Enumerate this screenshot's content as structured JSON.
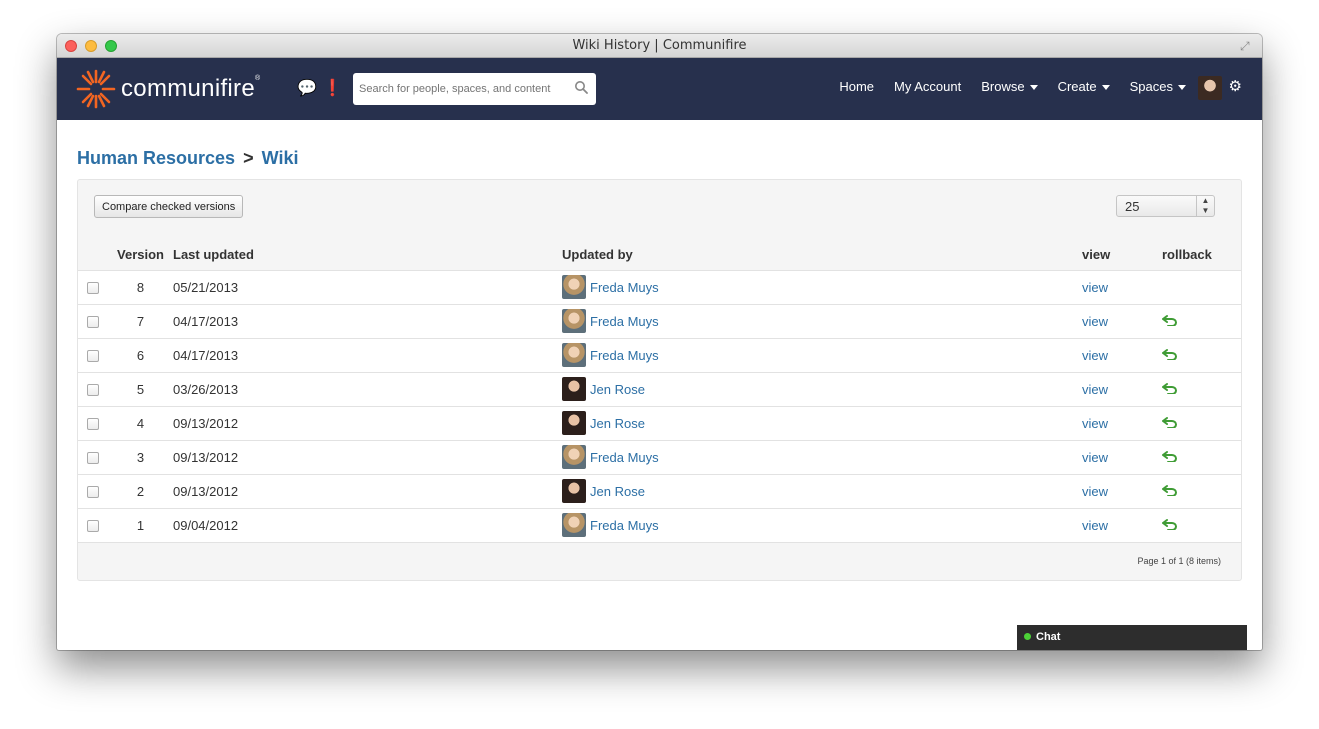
{
  "window": {
    "title": "Wiki History | Communifire"
  },
  "navbar": {
    "logo_text": "communifire",
    "search_placeholder": "Search for people, spaces, and content",
    "links": [
      {
        "label": "Home"
      },
      {
        "label": "My Account"
      },
      {
        "label": "Browse"
      },
      {
        "label": "Create"
      },
      {
        "label": "Spaces"
      }
    ]
  },
  "breadcrumb": {
    "space": "Human Resources",
    "separator": ">",
    "page": "Wiki"
  },
  "toolbar": {
    "compare_label": "Compare checked versions",
    "page_size": "25"
  },
  "table": {
    "headers": {
      "version": "Version",
      "last_updated": "Last updated",
      "updated_by": "Updated by",
      "view": "view",
      "rollback": "rollback"
    },
    "rows": [
      {
        "version": "8",
        "date": "05/21/2013",
        "user": "Freda Muys",
        "view": "view"
      },
      {
        "version": "7",
        "date": "04/17/2013",
        "user": "Freda Muys",
        "view": "view"
      },
      {
        "version": "6",
        "date": "04/17/2013",
        "user": "Freda Muys",
        "view": "view"
      },
      {
        "version": "5",
        "date": "03/26/2013",
        "user": "Jen Rose",
        "view": "view"
      },
      {
        "version": "4",
        "date": "09/13/2012",
        "user": "Jen Rose",
        "view": "view"
      },
      {
        "version": "3",
        "date": "09/13/2012",
        "user": "Freda Muys",
        "view": "view"
      },
      {
        "version": "2",
        "date": "09/13/2012",
        "user": "Jen Rose",
        "view": "view"
      },
      {
        "version": "1",
        "date": "09/04/2012",
        "user": "Freda Muys",
        "view": "view"
      }
    ]
  },
  "pager": {
    "text": "Page 1 of 1 (8 items)"
  },
  "chat": {
    "label": "Chat"
  },
  "colors": {
    "navbar": "#27304d",
    "link": "#2c6fa5",
    "rollback": "#3f9c35",
    "logo_orange": "#f26522"
  }
}
